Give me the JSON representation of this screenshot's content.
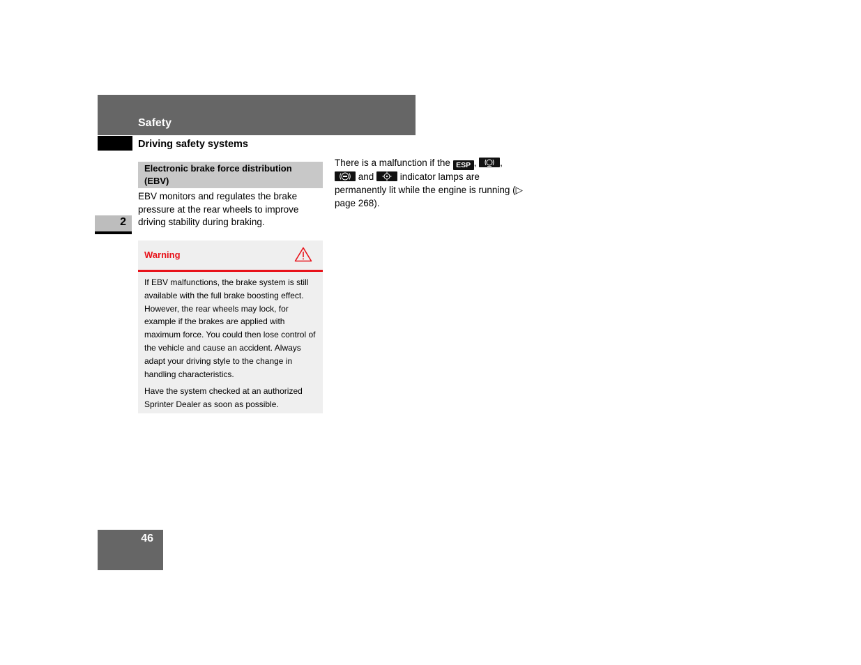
{
  "header": {
    "title": "Safety",
    "subtitle": "Driving safety systems"
  },
  "chapter": {
    "number": "2"
  },
  "section": {
    "heading": "Electronic brake force distribution (EBV)",
    "intro": "EBV monitors and regulates the brake pressure at the rear wheels to improve driving stability during braking."
  },
  "warning": {
    "label": "Warning",
    "icon": "warning-triangle-icon",
    "paragraphs": [
      "If EBV malfunctions, the brake system is still available with the full brake boosting effect. However, the rear wheels may lock, for example if the brakes are applied with maximum force. You could then lose control of the vehicle and cause an accident. Always adapt your driving style to the change in handling characteristics.",
      "Have the system checked at an authorized Sprinter Dealer as soon as possible."
    ],
    "accent_color": "#e8121a"
  },
  "malfunction": {
    "text_before": "There is a malfunction if the ",
    "esp_label": "ESP",
    "sep1": ", ",
    "sep2": ",",
    "and_text": " and ",
    "text_after": " indicator lamps are permanently lit while the engine is running (",
    "ref_arrow": "▷",
    "ref_text": " page 268).",
    "icons": [
      "esp-lamp-icon",
      "brake-pad-lamp-icon",
      "abs-lamp-icon",
      "brake-assist-lamp-icon"
    ]
  },
  "footer": {
    "page_number": "46"
  }
}
